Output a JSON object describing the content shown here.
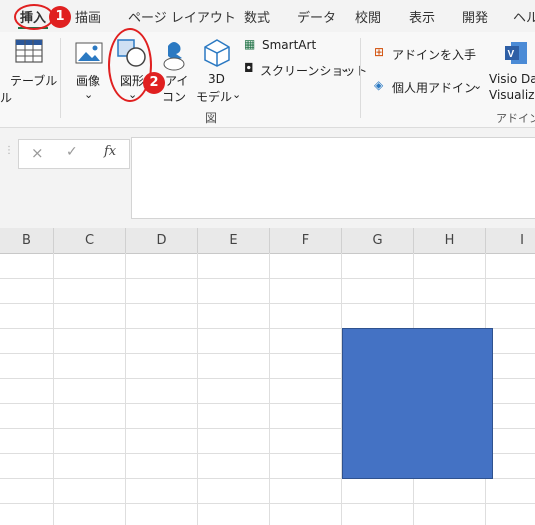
{
  "tabs": [
    {
      "label": "挿入"
    },
    {
      "label": "描画"
    },
    {
      "label": "ページ レイアウト"
    },
    {
      "label": "数式"
    },
    {
      "label": "データ"
    },
    {
      "label": "校閲"
    },
    {
      "label": "表示"
    },
    {
      "label": "開発"
    },
    {
      "label": "ヘル"
    }
  ],
  "ribbon": {
    "table_label": "テーブル",
    "table_sub": "ル",
    "image_label": "画像",
    "shapes_label": "図形",
    "icons_label_1": "アイ",
    "icons_label_2": "コン",
    "model_label_1": "3D",
    "model_label_2": "モデル",
    "smartart_label": "SmartArt",
    "screenshot_label": "スクリーンショット",
    "group_label": "図",
    "get_addins_label": "アドインを入手",
    "my_addins_label": "個人用アドイン",
    "visio_label_1": "Visio Da",
    "visio_label_2": "Visualize",
    "addins_group_label": "アドイン"
  },
  "formula_bar": {
    "cancel_icon": "×",
    "enter_icon": "✓",
    "fx_label": "fx",
    "value": ""
  },
  "columns": [
    "B",
    "C",
    "D",
    "E",
    "F",
    "G",
    "H",
    "I"
  ],
  "annotations": {
    "step1": "1",
    "step2": "2"
  },
  "colors": {
    "shape_fill": "#4472c4",
    "annotation_red": "#e02020"
  }
}
